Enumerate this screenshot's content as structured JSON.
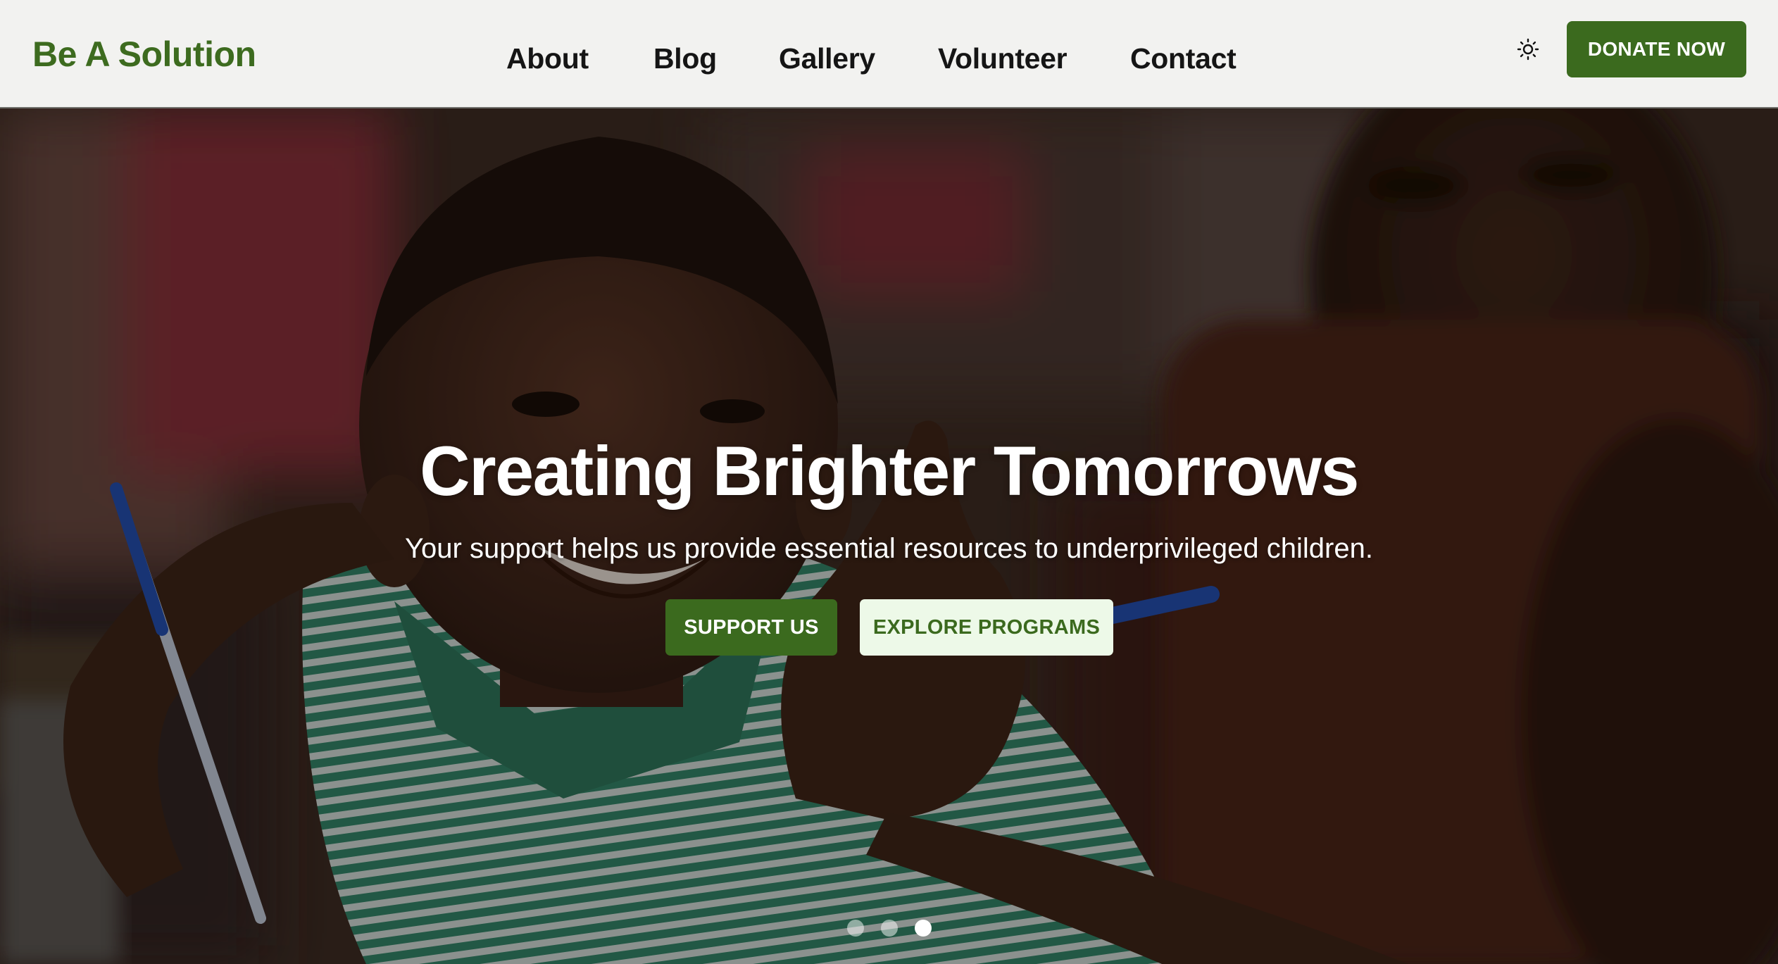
{
  "header": {
    "logo": "Be A Solution",
    "nav": [
      {
        "label": "About"
      },
      {
        "label": "Blog"
      },
      {
        "label": "Gallery"
      },
      {
        "label": "Volunteer"
      },
      {
        "label": "Contact"
      }
    ],
    "theme_toggle_icon": "sun-icon",
    "donate_label": "DONATE NOW"
  },
  "hero": {
    "title": "Creating Brighter Tomorrows",
    "subtitle": "Your support helps us provide essential resources to underprivileged children.",
    "primary_cta": "SUPPORT US",
    "secondary_cta": "EXPLORE PROGRAMS",
    "slides_total": 3,
    "active_slide": 3
  },
  "colors": {
    "brand_green": "#3b6a1e",
    "logo_green": "#3d6b1f",
    "header_bg": "#f2f2f0",
    "secondary_button_bg": "#edf9e8"
  }
}
